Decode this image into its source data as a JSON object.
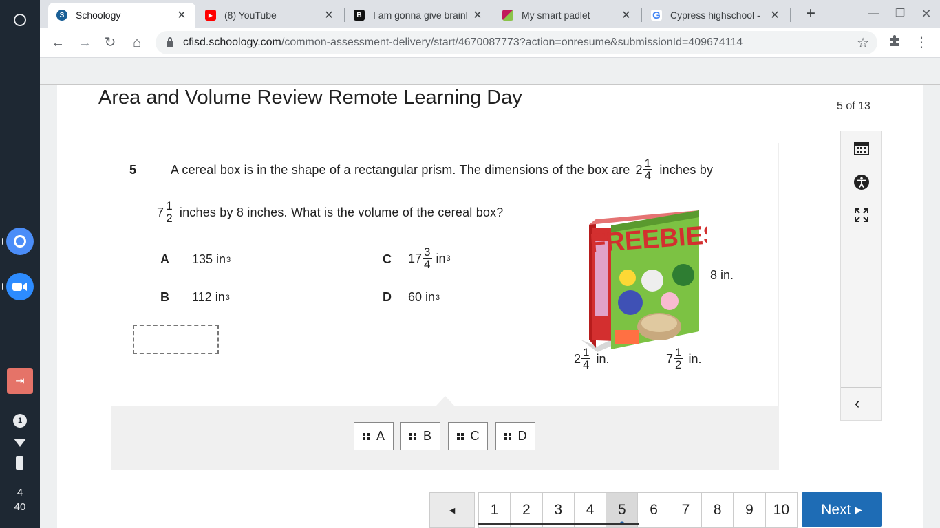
{
  "tray": {
    "notifications": "1",
    "time_hour": "4",
    "time_minute": "40"
  },
  "browser": {
    "tabs": [
      {
        "title": "Schoology",
        "icon": "schoology-icon",
        "color": "#1a5f96",
        "glyph": "S"
      },
      {
        "title": "(8) YouTube",
        "icon": "youtube-icon",
        "color": "#ff0000",
        "glyph": "▶"
      },
      {
        "title": "I am gonna give brainl",
        "icon": "brainly-icon",
        "color": "#111111",
        "glyph": "B"
      },
      {
        "title": "My smart padlet",
        "icon": "padlet-icon",
        "color": "#c2185b",
        "glyph": ""
      },
      {
        "title": "Cypress highschool -",
        "icon": "google-icon",
        "color": "#4285f4",
        "glyph": "G"
      }
    ],
    "url_domain": "cfisd.schoology.com",
    "url_path": "/common-assessment-delivery/start/4670087773?action=onresume&submissionId=409674114"
  },
  "assessment": {
    "title": "Area and Volume Review Remote Learning Day",
    "progress": "5 of 13"
  },
  "question": {
    "number": "5",
    "line1_text": "A cereal box is in the shape of a rectangular prism. The dimensions of the box are",
    "line1_whole": "2",
    "line1_num": "1",
    "line1_den": "4",
    "line1_suffix": "inches by",
    "line2_whole": "7",
    "line2_num": "1",
    "line2_den": "2",
    "line2_text": "inches by 8 inches. What is the volume of the cereal box?",
    "choices": {
      "a": {
        "letter": "A",
        "value": "135 in",
        "exp": "3"
      },
      "b": {
        "letter": "B",
        "value": "112 in",
        "exp": "3"
      },
      "c": {
        "letter": "C",
        "whole": "17",
        "num": "3",
        "den": "4",
        "unit": "in",
        "exp": "3"
      },
      "d": {
        "letter": "D",
        "value": "60 in",
        "exp": "3"
      }
    },
    "figure": {
      "brand": "FREEBIES",
      "height_label": "8  in.",
      "width_whole": "2",
      "width_num": "1",
      "width_den": "4",
      "width_unit": "in.",
      "length_whole": "7",
      "length_num": "1",
      "length_den": "2",
      "length_unit": "in."
    }
  },
  "drag_tiles": [
    "A",
    "B",
    "C",
    "D"
  ],
  "pagination": {
    "pages": [
      "1",
      "2",
      "3",
      "4",
      "5",
      "6",
      "7",
      "8",
      "9",
      "10"
    ],
    "current": "5",
    "prev_label": "◄",
    "next_label": "Next ▸"
  },
  "colors": {
    "next_button": "#1e6cb5",
    "shelf": "#1e2833"
  }
}
